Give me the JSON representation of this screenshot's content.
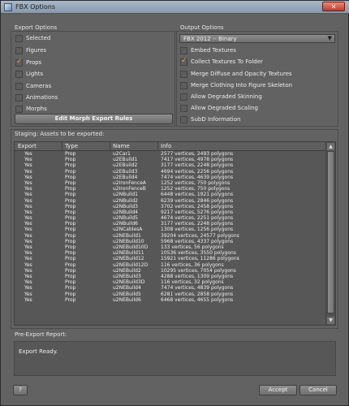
{
  "window": {
    "title": "FBX Options",
    "close_glyph": "✕"
  },
  "export_options": {
    "title": "Export Options",
    "items": [
      {
        "label": "Selected",
        "checked": false
      },
      {
        "label": "Figures",
        "checked": false
      },
      {
        "label": "Props",
        "checked": true
      },
      {
        "label": "Lights",
        "checked": false
      },
      {
        "label": "Cameras",
        "checked": false
      },
      {
        "label": "Animations",
        "checked": false
      },
      {
        "label": "Morphs",
        "checked": false
      }
    ],
    "edit_morph_button": "Edit Morph Export Rules"
  },
  "output_options": {
    "title": "Output Options",
    "format_selected": "FBX 2012 -- Binary",
    "items": [
      {
        "label": "Embed Textures",
        "checked": false
      },
      {
        "label": "Collect Textures To Folder",
        "checked": true
      },
      {
        "label": "Merge Diffuse and Opacity Textures",
        "checked": false
      },
      {
        "label": "Merge Clothing Into Figure Skeleton",
        "checked": false
      },
      {
        "label": "Allow Degraded Skinning",
        "checked": false
      },
      {
        "label": "Allow Degraded Scaling",
        "checked": false
      },
      {
        "label": "SubD Information",
        "checked": false
      }
    ]
  },
  "staging": {
    "title": "Staging: Assets to be exported:",
    "columns": [
      "Export",
      "Type",
      "Name",
      "Info"
    ],
    "rows": [
      [
        "Yes",
        "Prop",
        "u2Car1",
        "2577 vertices, 2493 polygons"
      ],
      [
        "Yes",
        "Prop",
        "u2EBuild1",
        "7417 vertices, 4978 polygons"
      ],
      [
        "Yes",
        "Prop",
        "u2EBuild2",
        "3177 vertices, 2248 polygons"
      ],
      [
        "Yes",
        "Prop",
        "u2EBuild3",
        "4694 vertices, 2256 polygons"
      ],
      [
        "Yes",
        "Prop",
        "u2EBuild4",
        "7474 vertices, 4639 polygons"
      ],
      [
        "Yes",
        "Prop",
        "u2IronFenceA",
        "1252 vertices, 750 polygons"
      ],
      [
        "Yes",
        "Prop",
        "u2IronFenceB",
        "1252 vertices, 750 polygons"
      ],
      [
        "Yes",
        "Prop",
        "u2NBuild1",
        "6448 vertices, 1921 polygons"
      ],
      [
        "Yes",
        "Prop",
        "u2NBuild2",
        "6239 vertices, 2846 polygons"
      ],
      [
        "Yes",
        "Prop",
        "u2NBuild3",
        "3702 vertices, 2458 polygons"
      ],
      [
        "Yes",
        "Prop",
        "u2NBuild4",
        "9217 vertices, 5276 polygons"
      ],
      [
        "Yes",
        "Prop",
        "u2NBuild5",
        "4674 vertices, 2251 polygons"
      ],
      [
        "Yes",
        "Prop",
        "u2NBuild6",
        "3177 vertices, 2248 polygons"
      ],
      [
        "Yes",
        "Prop",
        "u2NCablesA",
        "1308 vertices, 1256 polygons"
      ],
      [
        "Yes",
        "Prop",
        "u2NEBuild1",
        "39204 vertices, 24577 polygons"
      ],
      [
        "Yes",
        "Prop",
        "u2NEBuild10",
        "5968 vertices, 4337 polygons"
      ],
      [
        "Yes",
        "Prop",
        "u2NEBuild10D",
        "133 vertices, 56 polygons"
      ],
      [
        "Yes",
        "Prop",
        "u2NEBuild11",
        "10536 vertices, 3550 polygons"
      ],
      [
        "Yes",
        "Prop",
        "u2NEBuild12",
        "15921 vertices, 11286 polygons"
      ],
      [
        "Yes",
        "Prop",
        "u2NEBuild12D",
        "116 vertices, 36 polygons"
      ],
      [
        "Yes",
        "Prop",
        "u2NEBuild2",
        "10295 vertices, 7054 polygons"
      ],
      [
        "Yes",
        "Prop",
        "u2NEBuild3",
        "4288 vertices, 1309 polygons"
      ],
      [
        "Yes",
        "Prop",
        "u2NEBuild3D",
        "116 vertices, 32 polygons"
      ],
      [
        "Yes",
        "Prop",
        "u2NEBuild4",
        "7474 vertices, 4839 polygons"
      ],
      [
        "Yes",
        "Prop",
        "u2NEBuild5",
        "6281 vertices, 2858 polygons"
      ],
      [
        "Yes",
        "Prop",
        "u2NEBuild6",
        "6468 vertices, 4655 polygons"
      ]
    ]
  },
  "report": {
    "title": "Pre-Export Report:",
    "text": "Export Ready."
  },
  "footer": {
    "help_glyph": "?",
    "accept": "Accept",
    "cancel": "Cancel"
  },
  "colors": {
    "checkmark": "#f4a33a",
    "panel": "#626262",
    "titlebar": "#9aabbf"
  }
}
